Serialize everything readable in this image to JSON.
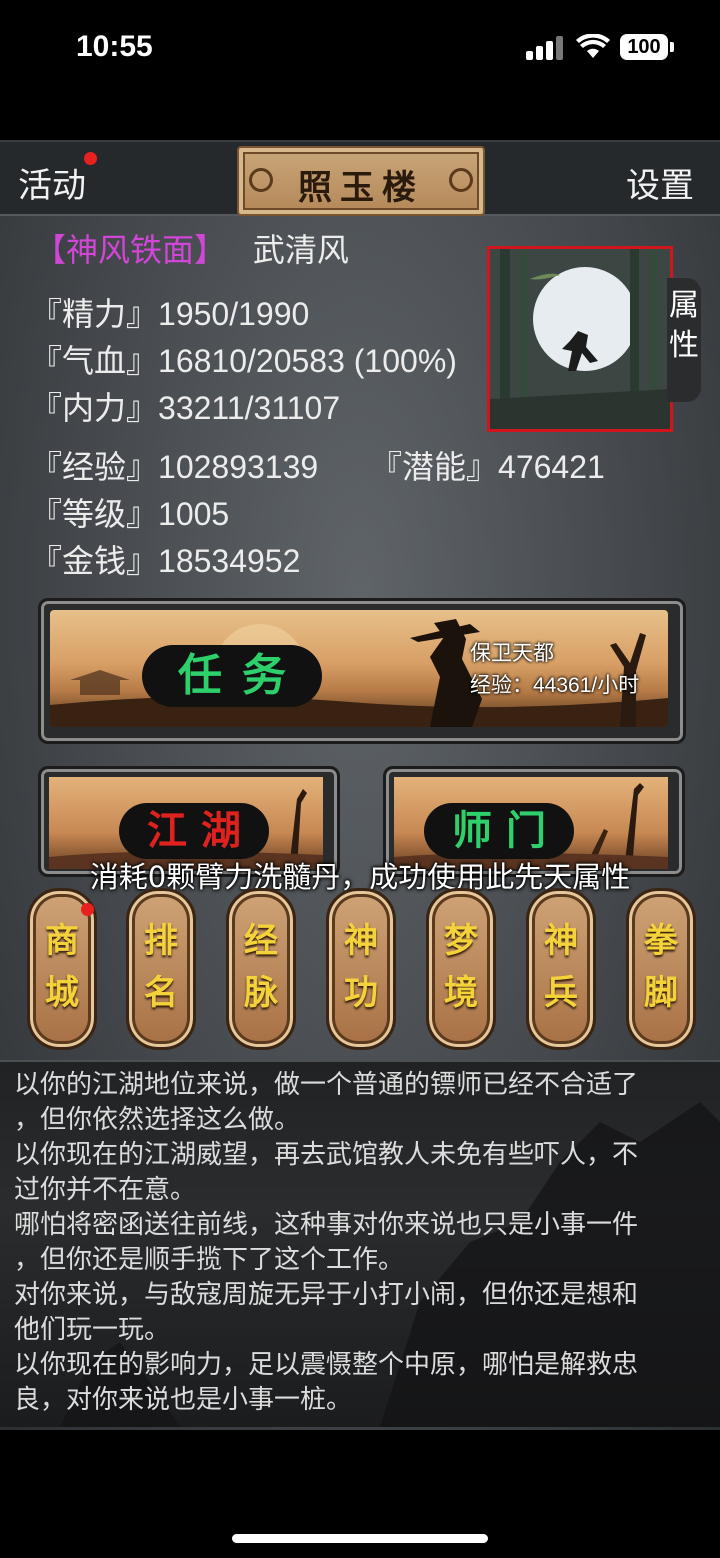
{
  "status_bar": {
    "time": "10:55",
    "battery": "100"
  },
  "header": {
    "activity": "活动",
    "title": "照玉楼",
    "settings": "设置"
  },
  "character": {
    "title_tag": "【神风铁面】",
    "name": "武清风",
    "stats": [
      {
        "label": "『精力』",
        "value": "1950/1990"
      },
      {
        "label": "『气血』",
        "value": "16810/20583 (100%)"
      },
      {
        "label": "『内力』",
        "value": "33211/31107"
      },
      {
        "label": "『经验』",
        "value": "102893139"
      },
      {
        "label": "『潜能』",
        "value": "476421"
      },
      {
        "label": "『等级』",
        "value": "1005"
      },
      {
        "label": "『金钱』",
        "value": "18534952"
      }
    ],
    "attr_tab": "属性"
  },
  "task": {
    "label": "任务",
    "mission": "保卫天都",
    "exp": "经验：44361/小时"
  },
  "sub_buttons": {
    "jianghu": "江湖",
    "shimen": "师门"
  },
  "toast": "消耗0颗臂力洗髓丹，成功使用此先天属性",
  "menu": [
    {
      "top": "商",
      "bottom": "城",
      "badge": true
    },
    {
      "top": "排",
      "bottom": "名"
    },
    {
      "top": "经",
      "bottom": "脉"
    },
    {
      "top": "神",
      "bottom": "功"
    },
    {
      "top": "梦",
      "bottom": "境"
    },
    {
      "top": "神",
      "bottom": "兵"
    },
    {
      "top": "拳",
      "bottom": "脚"
    }
  ],
  "log": [
    "以你的江湖地位来说，做一个普通的镖师已经不合适了",
    "，但你依然选择这么做。",
    "以你现在的江湖威望，再去武馆教人未免有些吓人，不",
    "过你并不在意。",
    "哪怕将密函送往前线，这种事对你来说也只是小事一件",
    "，但你还是顺手揽下了这个工作。",
    "对你来说，与敌寇周旋无异于小打小闹，但你还是想和",
    "他们玩一玩。",
    "以你现在的影响力，足以震慑整个中原，哪怕是解救忠",
    "良，对你来说也是小事一桩。"
  ],
  "colors": {
    "accent_red": "#d0151c",
    "title_purple": "#d146d6",
    "green_label": "#2ed06c",
    "red_label": "#e0221f",
    "gold_glyph": "#f4d23a"
  }
}
